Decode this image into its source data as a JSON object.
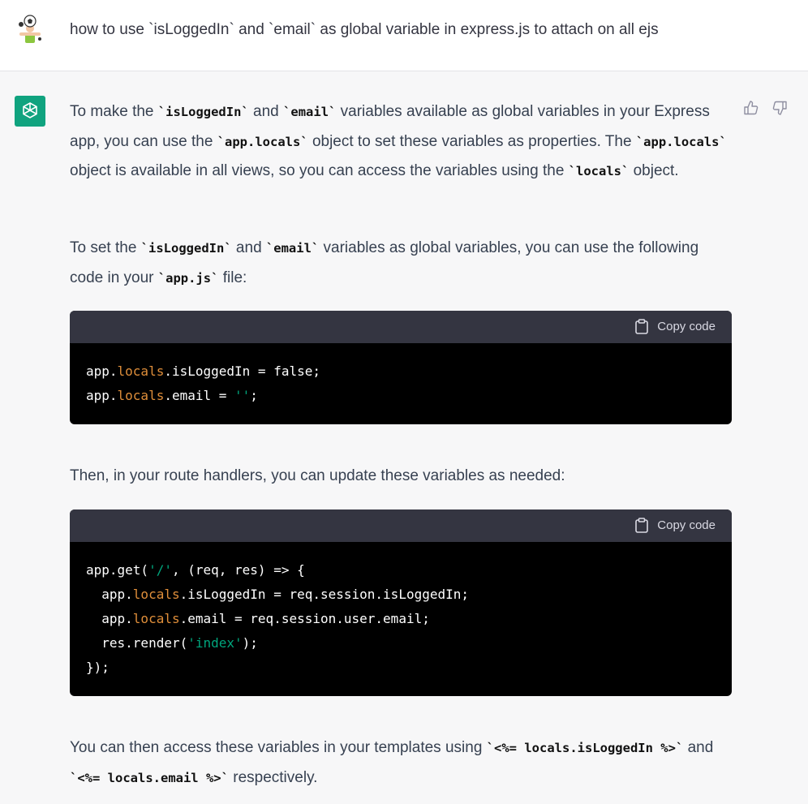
{
  "user_message": "how to use `isLoggedIn` and `email` as global variable in express.js to attach on all ejs",
  "feedback": {
    "up_icon": "thumbs-up-icon",
    "down_icon": "thumbs-down-icon"
  },
  "response": {
    "p1": [
      {
        "t": "To make the "
      },
      {
        "c": "`isLoggedIn`"
      },
      {
        "t": " and "
      },
      {
        "c": "`email`"
      },
      {
        "t": " variables available as global variables in your Express app, you can use the "
      },
      {
        "c": "`app.locals`"
      },
      {
        "t": " object to set these variables as properties. The "
      },
      {
        "c": "`app.locals`"
      },
      {
        "t": " object is available in all views, so you can access the variables using the "
      },
      {
        "c": "`locals`"
      },
      {
        "t": " object."
      }
    ],
    "p2": [
      {
        "t": "To set the "
      },
      {
        "c": "`isLoggedIn`"
      },
      {
        "t": " and "
      },
      {
        "c": "`email`"
      },
      {
        "t": " variables as global variables, you can use the following code in your "
      },
      {
        "c": "`app.js`"
      },
      {
        "t": " file:"
      }
    ],
    "p3": [
      {
        "t": "Then, in your route handlers, you can update these variables as needed:"
      }
    ],
    "p4": [
      {
        "t": "You can then access these variables in your templates using "
      },
      {
        "c": "`<%= locals.isLoggedIn %>`"
      },
      {
        "t": " and "
      },
      {
        "c": "`<%= locals.email %>`"
      },
      {
        "t": " respectively."
      }
    ],
    "copy_label": "Copy code",
    "code1": [
      [
        {
          "t": "app."
        },
        {
          "p": "locals"
        },
        {
          "t": ".isLoggedIn = false;"
        }
      ],
      [
        {
          "t": "app."
        },
        {
          "p": "locals"
        },
        {
          "t": ".email = "
        },
        {
          "s": "''"
        },
        {
          "t": ";"
        }
      ]
    ],
    "code2": [
      [
        {
          "t": "app.get("
        },
        {
          "s": "'/'"
        },
        {
          "t": ", (req, res) => {"
        }
      ],
      [
        {
          "t": "  app."
        },
        {
          "p": "locals"
        },
        {
          "t": ".isLoggedIn = req.session.isLoggedIn;"
        }
      ],
      [
        {
          "t": "  app."
        },
        {
          "p": "locals"
        },
        {
          "t": ".email = req.session.user.email;"
        }
      ],
      [
        {
          "t": "  res.render("
        },
        {
          "s": "'index'"
        },
        {
          "t": ");"
        }
      ],
      [
        {
          "t": "});"
        }
      ]
    ]
  },
  "colors": {
    "code_prop": "#df8e3a",
    "code_string": "#00a67d",
    "accent": "#10a37f"
  }
}
